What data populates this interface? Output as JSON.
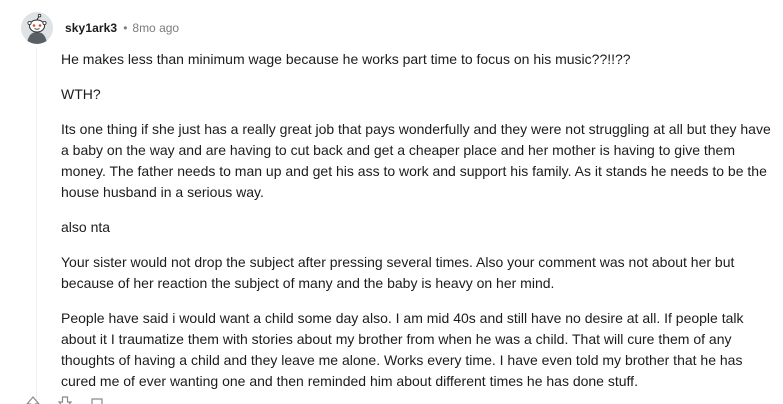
{
  "comment": {
    "username": "sky1ark3",
    "separator": "•",
    "timestamp": "8mo ago",
    "paragraphs": [
      "He makes less than minimum wage because he works part time to focus on his music??!!??",
      "WTH?",
      "Its one thing if she just has a really great job that pays wonderfully and they were not struggling at all but they have a baby on the way and are having to cut back and get a cheaper place and her mother is having to give them money. The father needs to man up and get his ass to work and support his family. As it stands he needs to be the house husband in a serious way.",
      "also nta",
      "Your sister would not drop the subject after pressing several times. Also your comment was not about her but because of her reaction the subject of many and the baby is heavy on her mind.",
      "People have said i would want a child some day also. I am mid 40s and still have no desire at all. If people talk about it I traumatize them with stories about my brother from when he was a child. That will cure them of any thoughts of having a child and they leave me alone. Works every time. I have even told my brother that he has cured me of ever wanting one and then reminded him about different times he has done stuff."
    ]
  }
}
